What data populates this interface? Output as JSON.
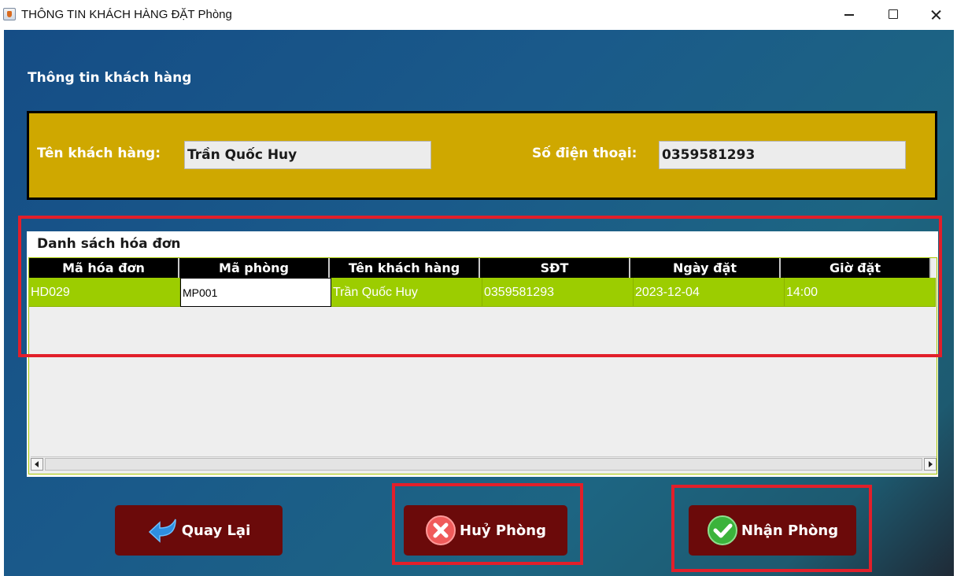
{
  "window": {
    "title": "THÔNG TIN KHÁCH HÀNG ĐẶT Phòng",
    "icon": "java-cup-icon"
  },
  "section_title": "Thông tin khách hàng",
  "customer": {
    "name_label": "Tên khách hàng:",
    "name_value": "Trần Quốc Huy",
    "phone_label": "Số điện thoại:",
    "phone_value": "0359581293"
  },
  "invoices": {
    "caption": "Danh sách hóa đơn",
    "columns": [
      "Mã hóa đơn",
      "Mã phòng",
      "Tên khách hàng",
      "SĐT",
      "Ngày đặt",
      "Giờ đặt"
    ],
    "rows": [
      [
        "HD029",
        "MP001",
        "Trần Quốc Huy",
        "0359581293",
        "2023-12-04",
        "14:00"
      ]
    ]
  },
  "buttons": {
    "back": "Quay Lại",
    "cancel": "Huỷ Phòng",
    "receive": "Nhận Phòng"
  },
  "colors": {
    "info_panel": "#cfa800",
    "row_selected": "#9ccd00",
    "button_bg": "#6b0a0a",
    "highlight": "#e21f2a"
  }
}
